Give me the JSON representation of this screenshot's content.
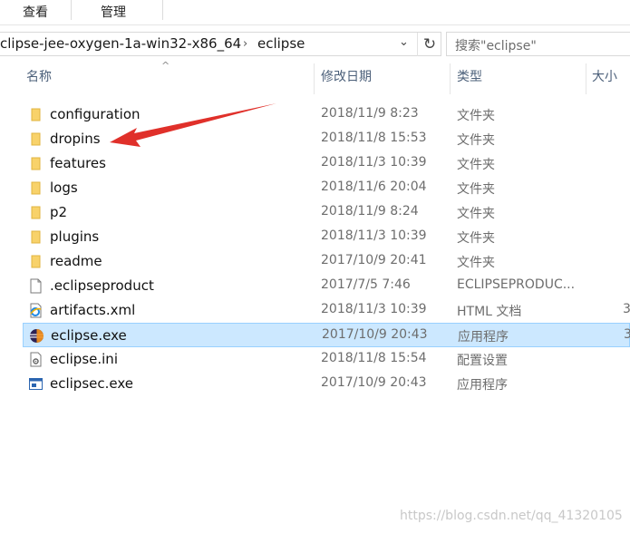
{
  "ribbon": {
    "tabs": [
      "查看",
      "管理"
    ]
  },
  "address_bar": {
    "segments": [
      "clipse-jee-oxygen-1a-win32-x86_64",
      "eclipse"
    ],
    "dropdown_icon": "chevron-down-icon",
    "refresh_icon": "refresh-icon"
  },
  "search": {
    "placeholder": "搜索\"eclipse\""
  },
  "columns": {
    "name": "名称",
    "date": "修改日期",
    "type": "类型",
    "size": "大小"
  },
  "files": [
    {
      "name": "configuration",
      "date": "2018/11/9 8:23",
      "type": "文件夹",
      "size": "",
      "icon": "folder-icon"
    },
    {
      "name": "dropins",
      "date": "2018/11/8 15:53",
      "type": "文件夹",
      "size": "",
      "icon": "folder-icon"
    },
    {
      "name": "features",
      "date": "2018/11/3 10:39",
      "type": "文件夹",
      "size": "",
      "icon": "folder-icon"
    },
    {
      "name": "logs",
      "date": "2018/11/6 20:04",
      "type": "文件夹",
      "size": "",
      "icon": "folder-icon"
    },
    {
      "name": "p2",
      "date": "2018/11/9 8:24",
      "type": "文件夹",
      "size": "",
      "icon": "folder-icon"
    },
    {
      "name": "plugins",
      "date": "2018/11/3 10:39",
      "type": "文件夹",
      "size": "",
      "icon": "folder-icon"
    },
    {
      "name": "readme",
      "date": "2017/10/9 20:41",
      "type": "文件夹",
      "size": "",
      "icon": "folder-icon"
    },
    {
      "name": ".eclipseproduct",
      "date": "2017/7/5 7:46",
      "type": "ECLIPSEPRODUC...",
      "size": "",
      "icon": "document-icon"
    },
    {
      "name": "artifacts.xml",
      "date": "2018/11/3 10:39",
      "type": "HTML 文档",
      "size": "3",
      "icon": "ie-icon"
    },
    {
      "name": "eclipse.exe",
      "date": "2017/10/9 20:43",
      "type": "应用程序",
      "size": "3",
      "icon": "eclipse-icon",
      "selected": true
    },
    {
      "name": "eclipse.ini",
      "date": "2018/11/8 15:54",
      "type": "配置设置",
      "size": "",
      "icon": "settings-file-icon"
    },
    {
      "name": "eclipsec.exe",
      "date": "2017/10/9 20:43",
      "type": "应用程序",
      "size": "",
      "icon": "app-window-icon"
    }
  ],
  "annotation": {
    "icon": "red-arrow-icon",
    "color": "#e0302a"
  },
  "colors": {
    "selection": "#cce8ff",
    "selection_border": "#99d1ff",
    "header_text": "#4c607a",
    "folder": "#f8d26a"
  },
  "watermark": "https://blog.csdn.net/qq_41320105"
}
